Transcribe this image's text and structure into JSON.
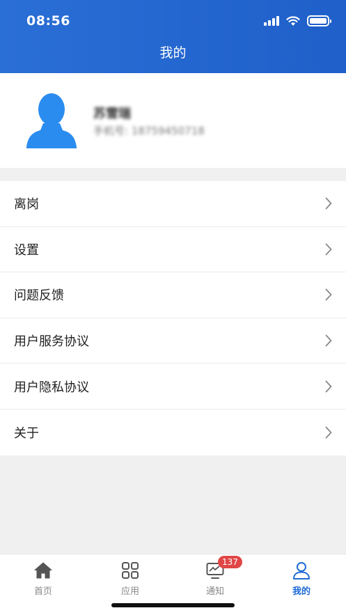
{
  "status_bar": {
    "time": "08:56"
  },
  "header": {
    "title": "我的"
  },
  "profile": {
    "name": "苏雪瑞",
    "phone": "手机号: 18759450718"
  },
  "menu": [
    {
      "label": "离岗"
    },
    {
      "label": "设置"
    },
    {
      "label": "问题反馈"
    },
    {
      "label": "用户服务协议"
    },
    {
      "label": "用户隐私协议"
    },
    {
      "label": "关于"
    }
  ],
  "tabbar": {
    "tabs": [
      {
        "label": "首页",
        "icon": "home-icon"
      },
      {
        "label": "应用",
        "icon": "grid-icon"
      },
      {
        "label": "通知",
        "icon": "monitor-icon",
        "badge": "137"
      },
      {
        "label": "我的",
        "icon": "user-icon",
        "active": true
      }
    ]
  },
  "colors": {
    "primary": "#1f6ad6",
    "badge": "#e04646",
    "avatar": "#2b8cf0"
  }
}
